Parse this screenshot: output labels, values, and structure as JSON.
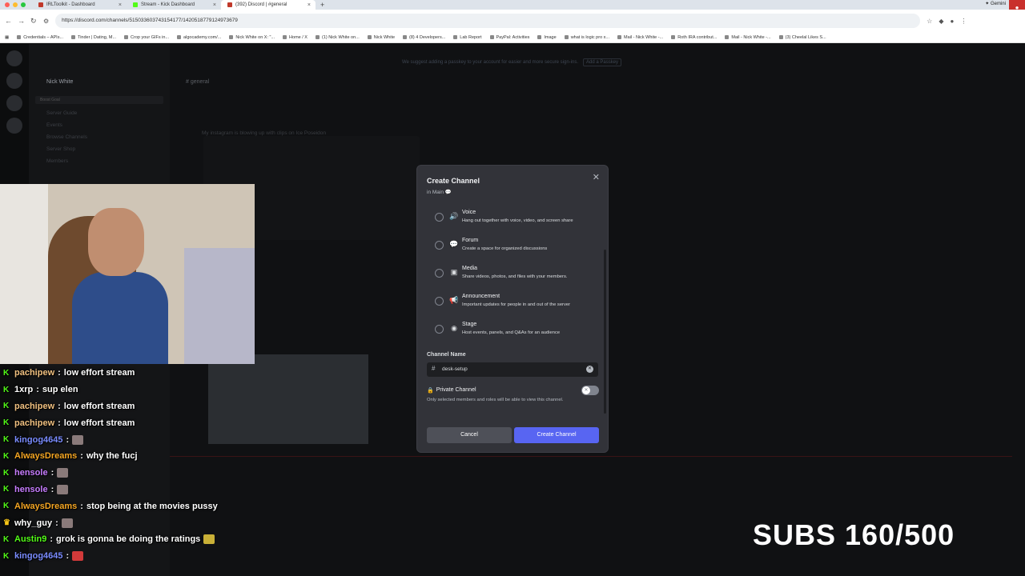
{
  "browser": {
    "tabs": [
      {
        "title": "IRLToolkit - Dashboard",
        "color": "#c0392b"
      },
      {
        "title": "Stream - Kick Dashboard",
        "color": "#53fc18"
      },
      {
        "title": "(392) Discord | #general",
        "color": "#c0392b"
      }
    ],
    "url": "https://discord.com/channels/515033603743154177/1420518779124973679",
    "gemini": "Gemini",
    "bookmarks": [
      "Credentials – APIs...",
      "Tinder | Dating, M...",
      "Crop your GIFs in...",
      "algocademy.com/...",
      "Nick White on X: \"...",
      "Home / X",
      "(1) Nick White on...",
      "Nick White",
      "(8) 4 Developers...",
      "Lab Report",
      "PayPal: Activities",
      "Image",
      "what is logic pro x...",
      "Mail - Nick White -...",
      "Roth IRA contribut...",
      "Mail - Nick White -...",
      "(3) Cheelal Likes S..."
    ]
  },
  "discord": {
    "server_name": "Nick White",
    "boost": "Boost Goal",
    "nav": [
      "Server Guide",
      "Events",
      "Browse Channels",
      "Server Shop",
      "Members"
    ],
    "channel": "general",
    "notice": "We suggest adding a passkey to your account for easier and more secure sign-ins.",
    "notice_button": "Add a Passkey",
    "message_text": "My instagram is blowing up with clips on Ice Poseidon"
  },
  "modal": {
    "title": "Create Channel",
    "subtitle": "in Main",
    "options": [
      {
        "name": "Voice",
        "desc": "Hang out together with voice, video, and screen share",
        "icon": "speaker-icon"
      },
      {
        "name": "Forum",
        "desc": "Create a space for organized discussions",
        "icon": "forum-icon"
      },
      {
        "name": "Media",
        "desc": "Share videos, photos, and files with your members.",
        "icon": "image-icon"
      },
      {
        "name": "Announcement",
        "desc": "Important updates for people in and out of the server",
        "icon": "megaphone-icon"
      },
      {
        "name": "Stage",
        "desc": "Host events, panels, and Q&As for an audience",
        "icon": "stage-icon"
      }
    ],
    "channel_name_label": "Channel Name",
    "channel_name_value": "desk-setup",
    "private_label": "Private Channel",
    "private_desc": "Only selected members and roles will be able to view this channel.",
    "cancel": "Cancel",
    "create": "Create Channel"
  },
  "stream_chat": [
    {
      "user": "pachipew",
      "color": "#f0c080",
      "msg": "low effort stream"
    },
    {
      "user": "1xrp",
      "color": "#ffffff",
      "msg": "sup elen"
    },
    {
      "user": "pachipew",
      "color": "#f0c080",
      "msg": "low effort stream"
    },
    {
      "user": "pachipew",
      "color": "#f0c080",
      "msg": "low effort stream"
    },
    {
      "user": "kingog4645",
      "color": "#7a8cff",
      "msg": ""
    },
    {
      "user": "AlwaysDreams",
      "color": "#f5a623",
      "msg": "why the fucj"
    },
    {
      "user": "hensole",
      "color": "#c77dff",
      "msg": ""
    },
    {
      "user": "hensole",
      "color": "#c77dff",
      "msg": ""
    },
    {
      "user": "AlwaysDreams",
      "color": "#f5a623",
      "msg": "stop being at the movies pussy"
    },
    {
      "user": "why_guy",
      "color": "#ffffff",
      "msg": ""
    },
    {
      "user": "Austin9",
      "color": "#53fc18",
      "msg": "grok is gonna be doing the ratings"
    },
    {
      "user": "kingog4645",
      "color": "#7a8cff",
      "msg": ""
    }
  ],
  "overlay": {
    "subs": "SUBS 160/500"
  }
}
